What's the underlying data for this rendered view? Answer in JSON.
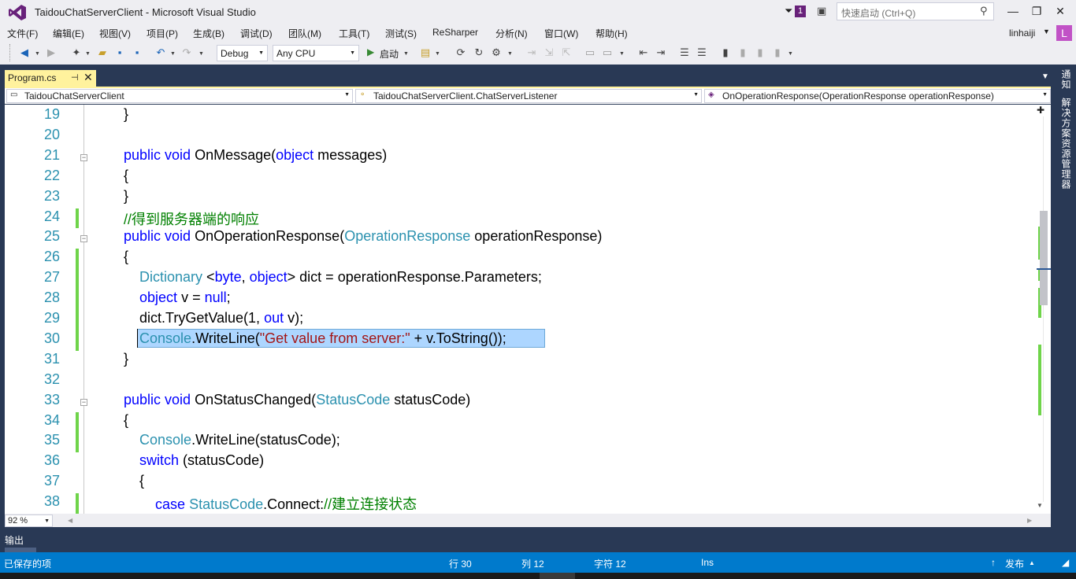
{
  "window": {
    "title": "TaidouChatServerClient - Microsoft Visual Studio",
    "notification_count": "1",
    "quick_launch_placeholder": "快速启动 (Ctrl+Q)",
    "minimize": "—",
    "maximize": "❐",
    "close": "✕"
  },
  "menu": {
    "items": [
      "文件(F)",
      "编辑(E)",
      "视图(V)",
      "项目(P)",
      "生成(B)",
      "调试(D)",
      "团队(M)",
      "工具(T)",
      "测试(S)",
      "ReSharper",
      "分析(N)",
      "窗口(W)",
      "帮助(H)"
    ],
    "user": "linhaiji",
    "avatar_letter": "L"
  },
  "toolbar": {
    "configuration": "Debug",
    "platform": "Any CPU",
    "start_label": "启动"
  },
  "tab": {
    "label": "Program.cs",
    "pin": "⊣",
    "close": "✕"
  },
  "side_rail": {
    "notifications": "通知",
    "solution_explorer": "解决方案资源管理器"
  },
  "navbar": {
    "project": "TaidouChatServerClient",
    "class": "TaidouChatServerClient.ChatServerListener",
    "member": "OnOperationResponse(OperationResponse operationResponse)"
  },
  "editor": {
    "line_numbers": [
      "19",
      "20",
      "21",
      "22",
      "23",
      "24",
      "25",
      "26",
      "27",
      "28",
      "29",
      "30",
      "31",
      "32",
      "33",
      "34",
      "35",
      "36",
      "37",
      "38"
    ],
    "lines": [
      [
        {
          "t": "}",
          "c": ""
        }
      ],
      [],
      [
        {
          "t": "public",
          "c": "kw"
        },
        {
          "t": " ",
          "c": ""
        },
        {
          "t": "void",
          "c": "kw"
        },
        {
          "t": " OnMessage(",
          "c": ""
        },
        {
          "t": "object",
          "c": "kw"
        },
        {
          "t": " messages)",
          "c": ""
        }
      ],
      [
        {
          "t": "{",
          "c": ""
        }
      ],
      [
        {
          "t": "}",
          "c": ""
        }
      ],
      [
        {
          "t": "//得到服务器端的响应",
          "c": "cm"
        }
      ],
      [
        {
          "t": "public",
          "c": "kw"
        },
        {
          "t": " ",
          "c": ""
        },
        {
          "t": "void",
          "c": "kw"
        },
        {
          "t": " OnOperationResponse(",
          "c": ""
        },
        {
          "t": "OperationResponse",
          "c": "ty"
        },
        {
          "t": " operationResponse)",
          "c": ""
        }
      ],
      [
        {
          "t": "{",
          "c": ""
        }
      ],
      [
        {
          "t": "    ",
          "c": ""
        },
        {
          "t": "Dictionary",
          "c": "ty"
        },
        {
          "t": " <",
          "c": ""
        },
        {
          "t": "byte",
          "c": "kw"
        },
        {
          "t": ", ",
          "c": ""
        },
        {
          "t": "object",
          "c": "kw"
        },
        {
          "t": "> dict = operationResponse.Parameters;",
          "c": ""
        }
      ],
      [
        {
          "t": "    ",
          "c": ""
        },
        {
          "t": "object",
          "c": "kw"
        },
        {
          "t": " v = ",
          "c": ""
        },
        {
          "t": "null",
          "c": "kw"
        },
        {
          "t": ";",
          "c": ""
        }
      ],
      [
        {
          "t": "    dict.TryGetValue(1, ",
          "c": ""
        },
        {
          "t": "out",
          "c": "kw"
        },
        {
          "t": " v);",
          "c": ""
        }
      ],
      [
        {
          "t": "    ",
          "c": ""
        },
        {
          "t": "Console",
          "c": "ty"
        },
        {
          "t": ".WriteLine(",
          "c": ""
        },
        {
          "t": "\"Get value from server:\"",
          "c": "st"
        },
        {
          "t": " + v.ToString());",
          "c": ""
        }
      ],
      [
        {
          "t": "}",
          "c": ""
        }
      ],
      [],
      [
        {
          "t": "public",
          "c": "kw"
        },
        {
          "t": " ",
          "c": ""
        },
        {
          "t": "void",
          "c": "kw"
        },
        {
          "t": " OnStatusChanged(",
          "c": ""
        },
        {
          "t": "StatusCode",
          "c": "ty"
        },
        {
          "t": " statusCode)",
          "c": ""
        }
      ],
      [
        {
          "t": "{",
          "c": ""
        }
      ],
      [
        {
          "t": "    ",
          "c": ""
        },
        {
          "t": "Console",
          "c": "ty"
        },
        {
          "t": ".WriteLine(statusCode);",
          "c": ""
        }
      ],
      [
        {
          "t": "    ",
          "c": ""
        },
        {
          "t": "switch",
          "c": "kw"
        },
        {
          "t": " (statusCode)",
          "c": ""
        }
      ],
      [
        {
          "t": "    {",
          "c": ""
        }
      ],
      [
        {
          "t": "        ",
          "c": ""
        },
        {
          "t": "case",
          "c": "kw"
        },
        {
          "t": " ",
          "c": ""
        },
        {
          "t": "StatusCode",
          "c": "ty"
        },
        {
          "t": ".Connect:",
          "c": ""
        },
        {
          "t": "//建立连接状态",
          "c": "cm"
        }
      ]
    ],
    "zoom": "92 %"
  },
  "output": {
    "tab_label": "输出"
  },
  "status": {
    "message": "已保存的项",
    "line": "行 30",
    "column": "列 12",
    "char": "字符 12",
    "mode": "Ins",
    "publish": "发布"
  },
  "colors": {
    "keyword": "#0000ff",
    "type": "#2b91af",
    "comment": "#008000",
    "string": "#a31515",
    "statusbar": "#007acc",
    "frame": "#293955",
    "active_tab": "#fff29d"
  }
}
